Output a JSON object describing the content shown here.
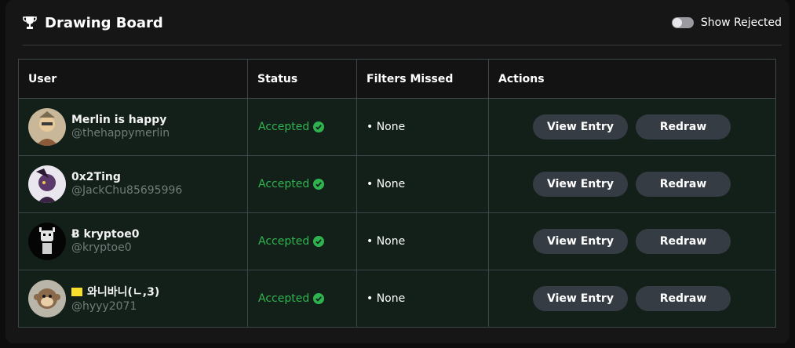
{
  "header": {
    "title": "Drawing Board",
    "toggle_label": "Show Rejected",
    "toggle_on": false
  },
  "table": {
    "columns": [
      "User",
      "Status",
      "Filters Missed",
      "Actions"
    ],
    "rows": [
      {
        "name": "Merlin is happy",
        "handle": "@thehappymerlin",
        "status": "Accepted",
        "filters": "• None",
        "view_label": "View Entry",
        "redraw_label": "Redraw"
      },
      {
        "name": "0x2Ting",
        "handle": "@JackChu85695996",
        "status": "Accepted",
        "filters": "• None",
        "view_label": "View Entry",
        "redraw_label": "Redraw"
      },
      {
        "name": "Ƀ kryptoe0",
        "handle": "@kryptoe0",
        "status": "Accepted",
        "filters": "• None",
        "view_label": "View Entry",
        "redraw_label": "Redraw"
      },
      {
        "name": "와니바니(ㄴ,3)",
        "handle": "@hyyy2071",
        "status": "Accepted",
        "filters": "• None",
        "view_label": "View Entry",
        "redraw_label": "Redraw"
      }
    ]
  },
  "colors": {
    "accent_success": "#2fb34f",
    "button_bg": "#363c43",
    "row_bg": "#13201a"
  }
}
